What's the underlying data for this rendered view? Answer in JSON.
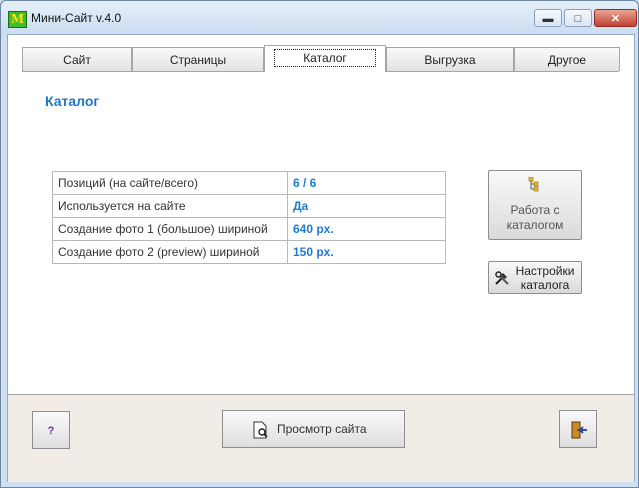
{
  "window": {
    "title": "Мини-Сайт v.4.0",
    "app_icon_letter": "M",
    "icons": [
      "app-logo-icon",
      "minimize-icon",
      "maximize-icon",
      "close-icon"
    ]
  },
  "tabs": [
    {
      "label": "Сайт",
      "active": false
    },
    {
      "label": "Страницы",
      "active": false
    },
    {
      "label": "Каталог",
      "active": true
    },
    {
      "label": "Выгрузка",
      "active": false
    },
    {
      "label": "Другое",
      "active": false
    }
  ],
  "section_title": "Каталог",
  "info_rows": [
    {
      "label": "Позиций (на сайте/всего)",
      "value": "6 / 6"
    },
    {
      "label": "Используется на сайте",
      "value": "Да"
    },
    {
      "label": "Создание фото 1 (большое) шириной",
      "value": "640 px."
    },
    {
      "label": "Создание фото 2 (preview) шириной",
      "value": "150 px."
    }
  ],
  "actions": {
    "catalog_label": "Работа с каталогом",
    "catalog_icon": "tree-icon",
    "settings_label": "Настройки каталога",
    "settings_icon": "tools-icon"
  },
  "footer": {
    "help_label": "?",
    "preview_label": "Просмотр сайта",
    "preview_icon": "document-search-icon",
    "exit_icon": "exit-door-icon"
  },
  "colors": {
    "accent": "#1e76c9",
    "value_text": "#1e7bd2",
    "footer_bg": "#f1ede6",
    "help_text": "#7a2bb0"
  }
}
